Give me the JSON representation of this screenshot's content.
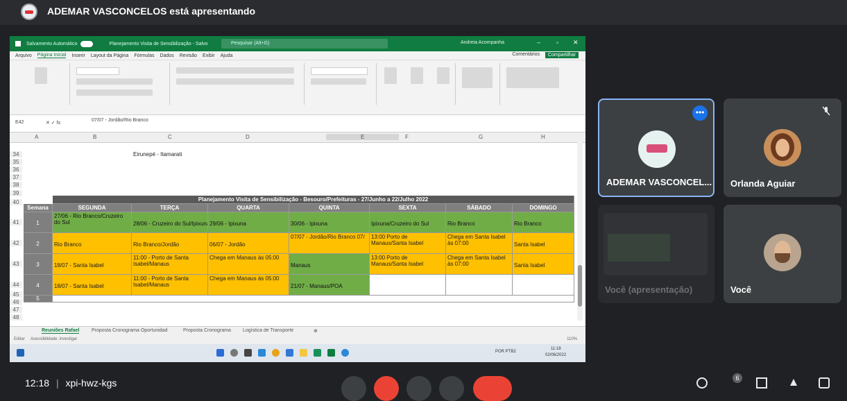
{
  "meet": {
    "presenting_banner": "ADEMAR VASCONCELOS está apresentando",
    "clock": "12:18",
    "meeting_code": "xpi-hwz-kgs",
    "participants": [
      {
        "name": "ADEMAR VASCONCEL..."
      },
      {
        "name": "Orlanda Aguiar"
      },
      {
        "name": "Você (apresentação)"
      },
      {
        "name": "Você"
      }
    ],
    "more_badge": "•••",
    "people_count": "6",
    "colors": {
      "background": "#202124",
      "tile": "#3c4043",
      "active_border": "#8ab4f8",
      "end_call": "#ea4335"
    }
  },
  "excel": {
    "search_placeholder": "Pesquisar (Alt+G)",
    "autosave": "Salvamento Automático",
    "file_title": "Planejamento Visita de Sensibilização - Salvo",
    "user": "Andreia Acompanha",
    "menu": [
      "Arquivo",
      "Página Inicial",
      "Inserir",
      "Layout da Página",
      "Fórmulas",
      "Dados",
      "Revisão",
      "Exibir",
      "Ajuda"
    ],
    "comments": "Comentários",
    "share": "Compartilhar",
    "cell_ref": "E42",
    "formula_content": "07/07 - Jordão/Rio Branco",
    "columns": [
      "A",
      "B",
      "C",
      "D",
      "E",
      "F",
      "G",
      "H"
    ],
    "row_numbers": [
      "34",
      "35",
      "36",
      "37",
      "38",
      "39",
      "40",
      "41",
      "42",
      "43",
      "44",
      "45",
      "46",
      "47",
      "48"
    ],
    "row34_text": "Eirunepé - Itamarati",
    "table_title": "Planejamento Visita de Sensibilização - Besouro/Prefeituras - 27/Junho a 22/Julho 2022",
    "headers": [
      "Semana",
      "SEGUNDA",
      "TERÇA",
      "QUARTA",
      "QUINTA",
      "SEXTA",
      "SÁBADO",
      "DOMINGO"
    ],
    "rows": [
      {
        "week": "1",
        "cells": [
          "27/06 - Rio Branco/Cruzeiro do Sul",
          "28/06 - Cruzeiro do Sul/Ipixuna",
          "29/06 - Ipixuna",
          "30/06 - Ipixuna",
          "Ipixuna/Cruzeiro do Sul",
          "Rio Branco",
          "Rio Branco"
        ]
      },
      {
        "week": "2",
        "cells": [
          "Rio Branco",
          "Rio Branco/Jordão",
          "06/07 - Jordão",
          "07/07 - Jordão/Rio Branco 07/",
          "13:00 Porto de Manaus/Santa Isabel",
          "Chega em Santa Isabel às 07:00",
          "Santa Isabel"
        ]
      },
      {
        "week": "3",
        "cells": [
          "18/07 - Santa Isabel",
          "11:00 - Porto de Santa Isabel/Manaus",
          "Chega em Manaus às 05:00",
          "Manaus",
          "13:00 Porto de Manaus/Santa Isabel",
          "Chega em Santa Isabel às 07:00",
          "Santa Isabel"
        ]
      },
      {
        "week": "4",
        "cells": [
          "18/07 - Santa Isabel",
          "11:00 - Porto de Santa Isabel/Manaus",
          "Chega em Manaus às 05:00",
          "21/07 - Manaus/POA",
          "",
          "",
          ""
        ]
      },
      {
        "week": "5",
        "cells": [
          "",
          "",
          "",
          "",
          "",
          "",
          ""
        ]
      }
    ],
    "sheet_tabs": [
      "Reuniões Rafael",
      "Proposta Cronograma Oportunidad",
      "Proposta Cronograma",
      "Logística de Transporte"
    ],
    "status_left": "Editar",
    "status_access": "Acessibilidade: investigar",
    "zoom": "110%",
    "task_lang": "POR PTB2",
    "task_time": "11:18",
    "task_date": "02/06/2022"
  }
}
